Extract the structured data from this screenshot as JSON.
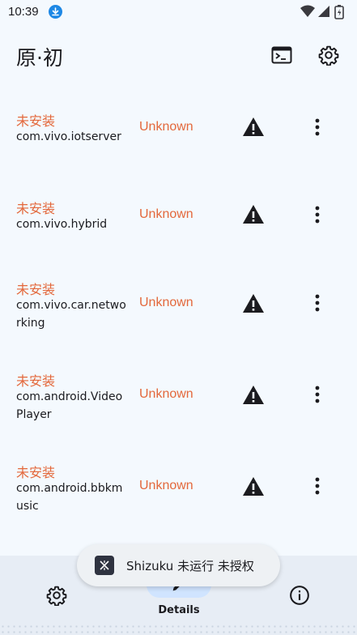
{
  "status_bar": {
    "time": "10:39",
    "icons": [
      "download-icon",
      "wifi-icon",
      "signal-icon",
      "battery-charging-icon"
    ]
  },
  "app_bar": {
    "title": "原·初",
    "actions": [
      "terminal-icon",
      "settings-icon"
    ]
  },
  "packages": [
    {
      "status": "未安装",
      "package": "com.vivo.iotserver",
      "version": "Unknown"
    },
    {
      "status": "未安装",
      "package": "com.vivo.hybrid",
      "version": "Unknown"
    },
    {
      "status": "未安装",
      "package": "com.vivo.car.networking",
      "version": "Unknown"
    },
    {
      "status": "未安装",
      "package": "com.android.VideoPlayer",
      "version": "Unknown"
    },
    {
      "status": "未安装",
      "package": "com.android.bbkmusic",
      "version": "Unknown"
    }
  ],
  "bottom_nav": {
    "items": [
      {
        "icon": "settings-icon",
        "label": ""
      },
      {
        "icon": "edit-icon",
        "label": "Details",
        "selected": true
      },
      {
        "icon": "info-icon",
        "label": ""
      }
    ]
  },
  "toast": {
    "text": "Shizuku 未运行 未授权",
    "icon": "shizuku-icon"
  },
  "colors": {
    "accent_warning": "#e3683b",
    "background": "#f4f9fe",
    "nav_background": "#e7edf5",
    "nav_indicator": "#d0e4ff"
  }
}
